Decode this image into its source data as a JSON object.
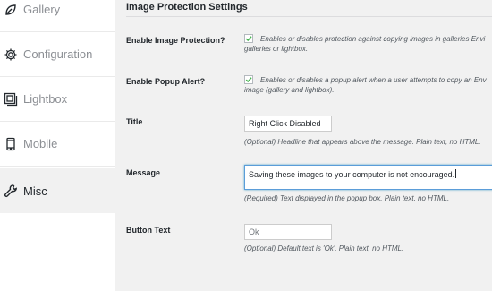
{
  "sidebar": {
    "items": [
      {
        "label": "Gallery",
        "icon": "leaf-icon"
      },
      {
        "label": "Configuration",
        "icon": "gear-icon"
      },
      {
        "label": "Lightbox",
        "icon": "lightbox-icon"
      },
      {
        "label": "Mobile",
        "icon": "mobile-icon"
      },
      {
        "label": "Misc",
        "icon": "wrench-icon",
        "active": true
      }
    ]
  },
  "main": {
    "section_title": "Image Protection Settings",
    "image_protection": {
      "label": "Enable Image Protection?",
      "checked": true,
      "description": "Enables or disables protection against copying images in galleries Envi galleries or lightbox."
    },
    "popup_alert": {
      "label": "Enable Popup Alert?",
      "checked": true,
      "description": "Enables or disables a popup alert when a user attempts to copy an Env image (gallery and lightbox)."
    },
    "title_field": {
      "label": "Title",
      "value": "Right Click Disabled",
      "description": "(Optional) Headline that appears above the message. Plain text, no HTML."
    },
    "message_field": {
      "label": "Message",
      "value": "Saving these images to your computer is not encouraged.",
      "description": "(Required) Text displayed in the popup box. Plain text, no HTML."
    },
    "button_text_field": {
      "label": "Button Text",
      "placeholder": "Ok",
      "description": "(Optional) Default text is 'Ok'. Plain text, no HTML."
    }
  },
  "colors": {
    "checkbox_green": "#46b450",
    "focus_border": "#5b9dd9"
  }
}
